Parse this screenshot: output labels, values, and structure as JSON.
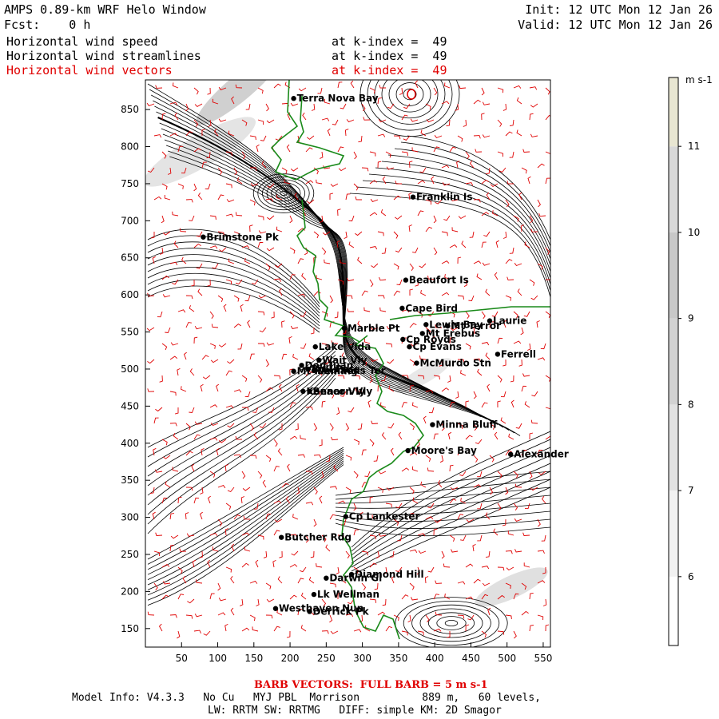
{
  "header": {
    "title": "AMPS 0.89-km WRF Helo Window",
    "fcst_label": "Fcst:",
    "fcst_value": "0 h",
    "init": "Init: 12 UTC Mon 12 Jan 26",
    "valid": "Valid: 12 UTC Mon 12 Jan 26",
    "fields": [
      {
        "name": "Horizontal wind speed",
        "level": "at k-index =  49",
        "color": "#000000"
      },
      {
        "name": "Horizontal wind streamlines",
        "level": "at k-index =  49",
        "color": "#000000"
      },
      {
        "name": "Horizontal wind vectors",
        "level": "at k-index =  49",
        "color": "#e00000"
      }
    ]
  },
  "map": {
    "x_range": [
      0,
      560
    ],
    "y_range": [
      125,
      890
    ],
    "x_ticks": [
      50,
      100,
      150,
      200,
      250,
      300,
      350,
      400,
      450,
      500,
      550
    ],
    "y_ticks": [
      150,
      200,
      250,
      300,
      350,
      400,
      450,
      500,
      550,
      600,
      650,
      700,
      750,
      800,
      850
    ],
    "colors": {
      "coast": "#1a8a1a",
      "barb": "#e00000",
      "streamline": "#000000"
    },
    "places": [
      {
        "name": "Terra Nova Bay",
        "x": 205,
        "y": 865
      },
      {
        "name": "Franklin Is",
        "x": 370,
        "y": 732
      },
      {
        "name": "Brimstone Pk",
        "x": 80,
        "y": 678
      },
      {
        "name": "Beaufort Is",
        "x": 360,
        "y": 620
      },
      {
        "name": "Cape Bird",
        "x": 355,
        "y": 582
      },
      {
        "name": "Lewis Bay",
        "x": 388,
        "y": 560
      },
      {
        "name": "Laurie",
        "x": 476,
        "y": 565
      },
      {
        "name": "Mt Terror",
        "x": 418,
        "y": 558
      },
      {
        "name": "Marble Pt",
        "x": 275,
        "y": 555
      },
      {
        "name": "Cp Royds",
        "x": 356,
        "y": 540
      },
      {
        "name": "Mt Erebus",
        "x": 383,
        "y": 548
      },
      {
        "name": "Lake Vida",
        "x": 235,
        "y": 530
      },
      {
        "name": "Cp Evans",
        "x": 365,
        "y": 530
      },
      {
        "name": "Ferrell",
        "x": 487,
        "y": 520
      },
      {
        "name": "Wait Vly",
        "x": 240,
        "y": 512
      },
      {
        "name": "McMurdo Stn",
        "x": 375,
        "y": 508
      },
      {
        "name": "Don Juan",
        "x": 216,
        "y": 505
      },
      {
        "name": "Bull Pass",
        "x": 225,
        "y": 500
      },
      {
        "name": "Mt Fleming",
        "x": 205,
        "y": 497
      },
      {
        "name": "Linnaeus Ter",
        "x": 233,
        "y": 498
      },
      {
        "name": "Kennar Vly",
        "x": 218,
        "y": 470
      },
      {
        "name": "Beacon Vly",
        "x": 227,
        "y": 470
      },
      {
        "name": "Minna Bluff",
        "x": 397,
        "y": 425
      },
      {
        "name": "Moore's Bay",
        "x": 363,
        "y": 390
      },
      {
        "name": "Alexander",
        "x": 505,
        "y": 385
      },
      {
        "name": "Cp Lankester",
        "x": 277,
        "y": 301
      },
      {
        "name": "Butcher Rdg",
        "x": 188,
        "y": 273
      },
      {
        "name": "Darwin Gl",
        "x": 250,
        "y": 218
      },
      {
        "name": "Diamond Hill",
        "x": 285,
        "y": 223
      },
      {
        "name": "Lk Wellman",
        "x": 233,
        "y": 196
      },
      {
        "name": "Westhaven Nun",
        "x": 180,
        "y": 177
      },
      {
        "name": "Derrick Pk",
        "x": 227,
        "y": 173
      }
    ]
  },
  "colorbar": {
    "units": "m s-1",
    "ticks": [
      6,
      7,
      8,
      9,
      10,
      11
    ],
    "range": [
      5.2,
      11.8
    ]
  },
  "footer": {
    "barb_note": "BARB VECTORS:  FULL BARB = 5 m s-1",
    "model_info": "Model Info: V4.3.3   No Cu   MYJ PBL  Morrison          889 m,   60 levels,",
    "physics": "LW: RRTM SW: RRTMG   DIFF: simple KM: 2D Smagor"
  }
}
